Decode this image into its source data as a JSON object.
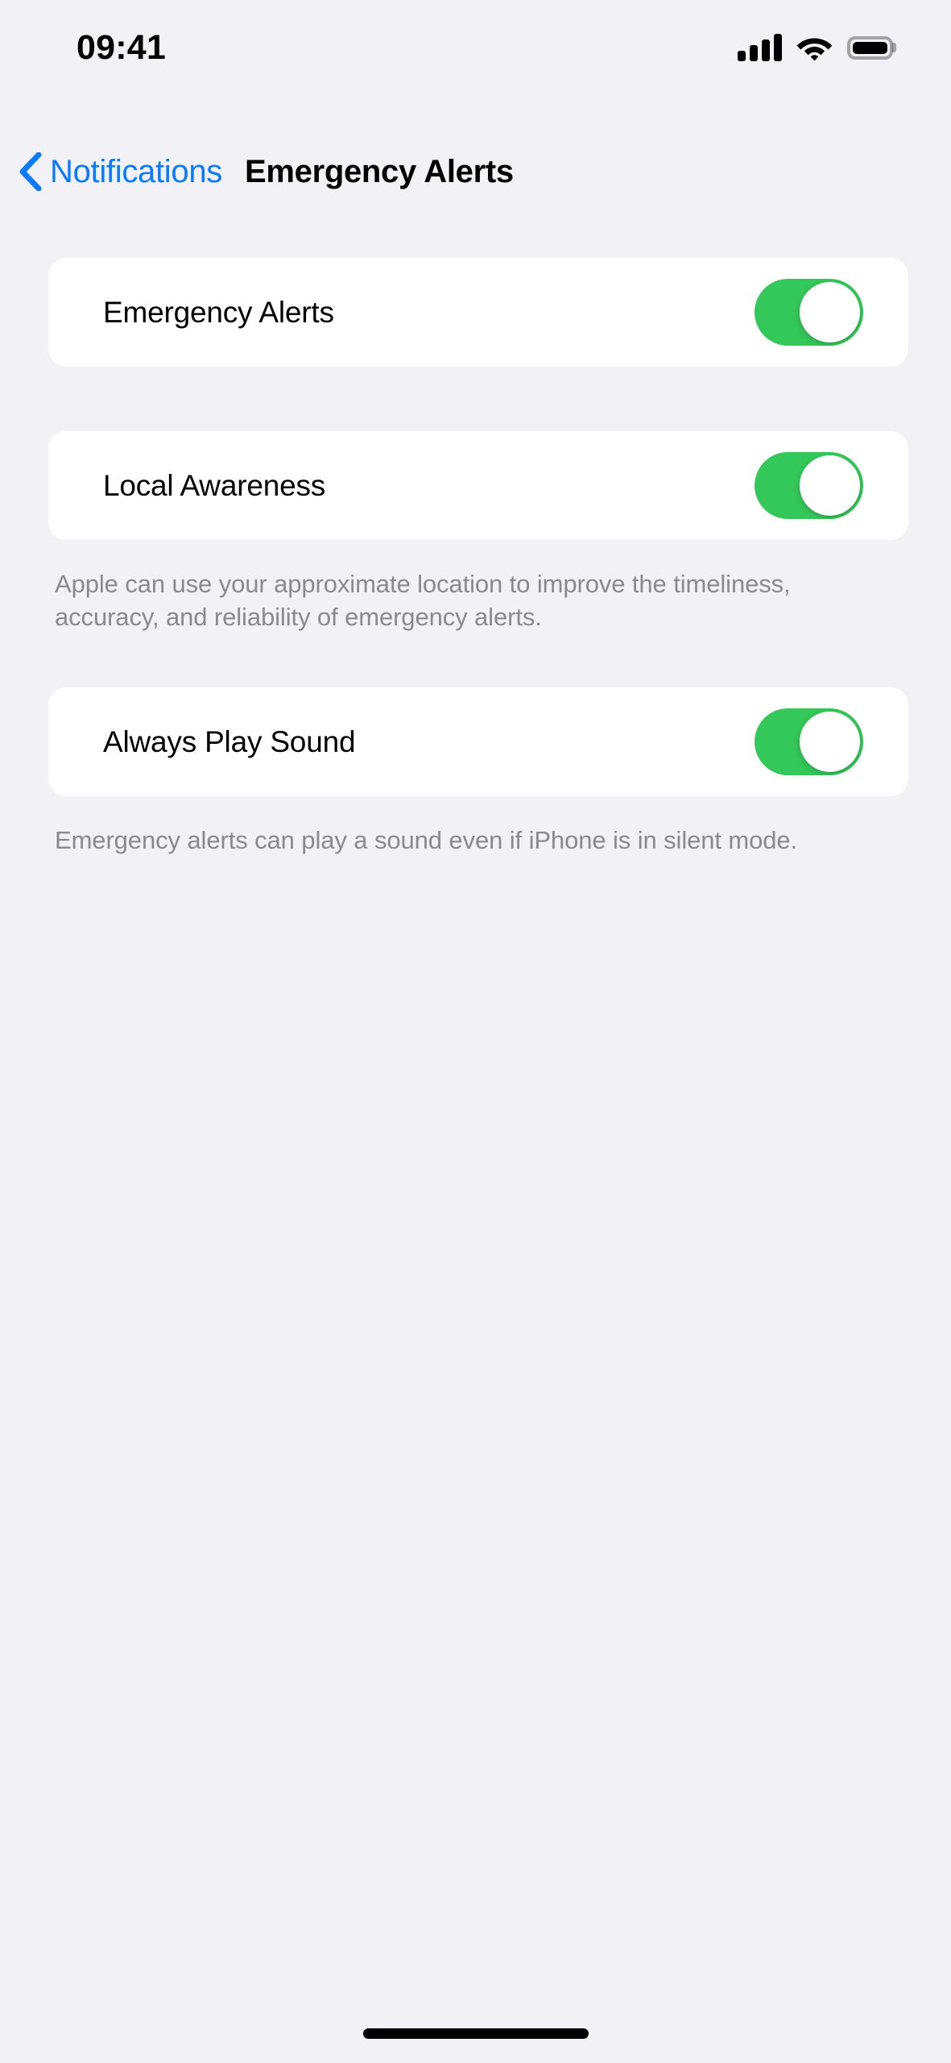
{
  "status_bar": {
    "time": "09:41",
    "cellular_icon": "cellular-signal-icon",
    "cellular_bars": 4,
    "wifi_icon": "wifi-icon",
    "battery_icon": "battery-icon",
    "battery_level": 100
  },
  "nav": {
    "back_icon": "chevron-left-icon",
    "back_label": "Notifications",
    "title": "Emergency Alerts"
  },
  "colors": {
    "accent_blue": "#0A7AFF",
    "toggle_on_green": "#34C759",
    "background": "#F1F1F6",
    "card": "#FFFFFF",
    "footer_text": "#8A8A8E"
  },
  "groups": [
    {
      "rows": [
        {
          "label": "Emergency Alerts",
          "control": "toggle",
          "value": "on"
        }
      ],
      "footer": ""
    },
    {
      "rows": [
        {
          "label": "Local Awareness",
          "control": "toggle",
          "value": "on"
        }
      ],
      "footer": "Apple can use your approximate location to improve the timeliness, accuracy, and reliability of emergency alerts."
    },
    {
      "rows": [
        {
          "label": "Always Play Sound",
          "control": "toggle",
          "value": "on"
        }
      ],
      "footer": "Emergency alerts can play a sound even if iPhone is in silent mode."
    }
  ],
  "home_indicator": "home-indicator"
}
